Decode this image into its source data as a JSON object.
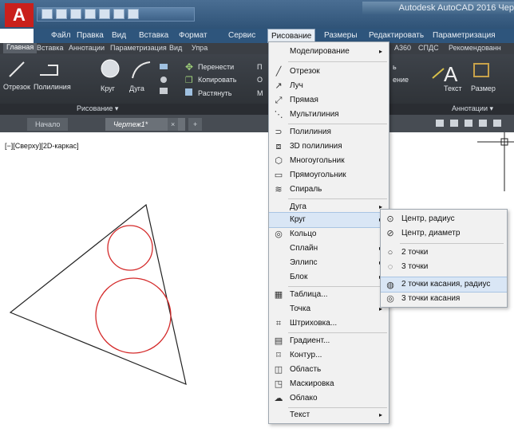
{
  "app": {
    "logo": "A",
    "title": "Autodesk AutoCAD 2016   Чер"
  },
  "menubar": [
    "Файл",
    "Правка",
    "Вид",
    "Вставка",
    "Формат",
    "Сервис",
    "Рисование",
    "Размеры",
    "Редактировать",
    "Параметризация"
  ],
  "ribbon_tabs": [
    "Главная",
    "Вставка",
    "Аннотации",
    "Параметризация",
    "Вид",
    "Упра",
    "A360",
    "СПДС",
    "Рекомендованн"
  ],
  "ribbon": {
    "draw_buttons": [
      "Отрезок",
      "Полилиния",
      "Круг",
      "Дуга"
    ],
    "modify_buttons": [
      "Перенести",
      "Копировать",
      "Растянуть"
    ],
    "partial_labels": [
      "П",
      "О",
      "М",
      "ь",
      "ение",
      "Текст",
      "Размер"
    ],
    "annot_letter": "A",
    "footer": {
      "draw": "Рисование ▾",
      "annot": "Аннотации ▾"
    }
  },
  "doc_tabs": [
    "Начало",
    "Чертеж1*",
    "×",
    "+"
  ],
  "viewport_label": "[−][Сверху][2D-каркас]",
  "dropdown": {
    "items": [
      {
        "icon": "",
        "label": "Моделирование",
        "arrow": "▸"
      },
      {
        "icon": "╱",
        "label": "Отрезок"
      },
      {
        "icon": "↗",
        "label": "Луч"
      },
      {
        "icon": "⤢",
        "label": "Прямая"
      },
      {
        "icon": "⋱",
        "label": "Мультилиния"
      },
      {
        "icon": "⊃",
        "label": "Полилиния"
      },
      {
        "icon": "⧈",
        "label": "3D полилиния"
      },
      {
        "icon": "⬡",
        "label": "Многоугольник"
      },
      {
        "icon": "▭",
        "label": "Прямоугольник"
      },
      {
        "icon": "≋",
        "label": "Спираль"
      },
      {
        "icon": "",
        "label": "Дуга",
        "arrow": "▸"
      },
      {
        "icon": "",
        "label": "Круг",
        "arrow": "▸"
      },
      {
        "icon": "◎",
        "label": "Кольцо"
      },
      {
        "icon": "",
        "label": "Сплайн",
        "arrow": "▸"
      },
      {
        "icon": "",
        "label": "Эллипс",
        "arrow": "▸"
      },
      {
        "icon": "",
        "label": "Блок",
        "arrow": "▸"
      },
      {
        "icon": "▦",
        "label": "Таблица..."
      },
      {
        "icon": "",
        "label": "Точка",
        "arrow": "▸"
      },
      {
        "icon": "⌗",
        "label": "Штриховка..."
      },
      {
        "icon": "▤",
        "label": "Градиент..."
      },
      {
        "icon": "⌑",
        "label": "Контур..."
      },
      {
        "icon": "◫",
        "label": "Область"
      },
      {
        "icon": "◳",
        "label": "Маскировка"
      },
      {
        "icon": "☁",
        "label": "Облако"
      },
      {
        "icon": "",
        "label": "Текст",
        "arrow": "▸"
      }
    ]
  },
  "submenu": {
    "items": [
      {
        "icon": "⊙",
        "label": "Центр, радиус"
      },
      {
        "icon": "⊘",
        "label": "Центр, диаметр"
      },
      {
        "icon": "○",
        "label": "2 точки"
      },
      {
        "icon": "◌",
        "label": "3 точки"
      },
      {
        "icon": "◍",
        "label": "2 точки касания, радиус"
      },
      {
        "icon": "◎",
        "label": "3 точки касания"
      }
    ]
  },
  "colors": {
    "drawing_circle": "#d42a2a",
    "drawing_line": "#222222",
    "highlight": "#d9e6f5"
  }
}
